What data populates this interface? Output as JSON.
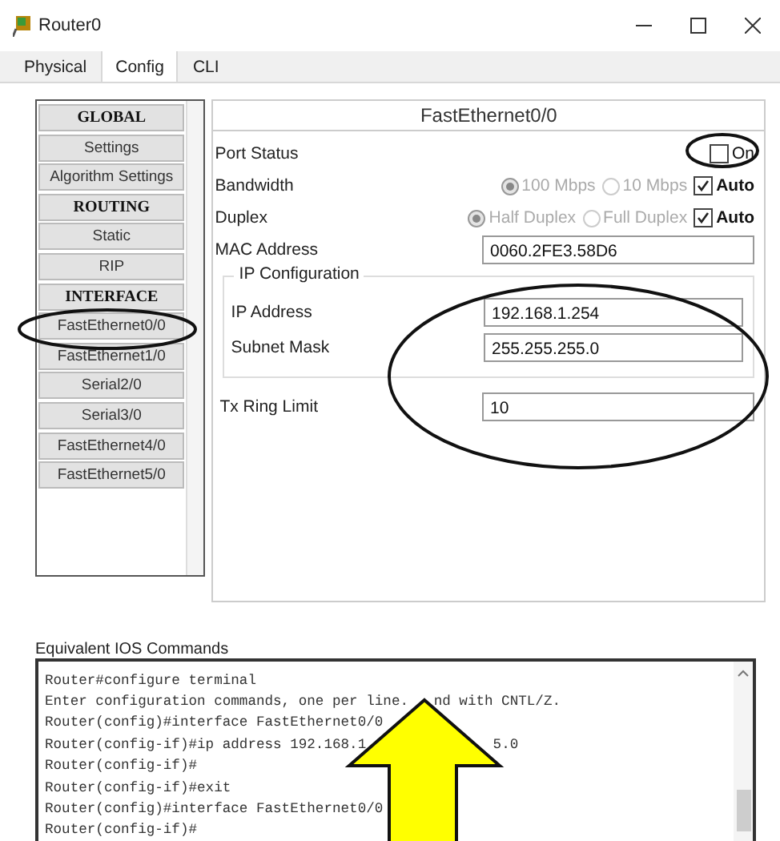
{
  "window": {
    "title": "Router0"
  },
  "tabs": [
    {
      "label": "Physical",
      "selected": false
    },
    {
      "label": "Config",
      "selected": true
    },
    {
      "label": "CLI",
      "selected": false
    }
  ],
  "sidebar": {
    "items": [
      {
        "kind": "header",
        "label": "GLOBAL"
      },
      {
        "kind": "item",
        "label": "Settings"
      },
      {
        "kind": "item",
        "label": "Algorithm Settings"
      },
      {
        "kind": "header",
        "label": "ROUTING"
      },
      {
        "kind": "item",
        "label": "Static"
      },
      {
        "kind": "item",
        "label": "RIP"
      },
      {
        "kind": "header",
        "label": "INTERFACE"
      },
      {
        "kind": "item",
        "label": "FastEthernet0/0"
      },
      {
        "kind": "item",
        "label": "FastEthernet1/0"
      },
      {
        "kind": "item",
        "label": "Serial2/0"
      },
      {
        "kind": "item",
        "label": "Serial3/0"
      },
      {
        "kind": "item",
        "label": "FastEthernet4/0"
      },
      {
        "kind": "item",
        "label": "FastEthernet5/0"
      }
    ]
  },
  "interface_panel": {
    "title": "FastEthernet0/0",
    "port_status": {
      "label": "Port Status",
      "option": {
        "label": "On",
        "checked": false
      }
    },
    "bandwidth": {
      "label": "Bandwidth",
      "disabled": true,
      "options": [
        {
          "label": "100 Mbps",
          "selected": true
        },
        {
          "label": "10 Mbps",
          "selected": false
        }
      ],
      "auto": {
        "label": "Auto",
        "checked": true
      }
    },
    "duplex": {
      "label": "Duplex",
      "disabled": true,
      "options": [
        {
          "label": "Half Duplex",
          "selected": true
        },
        {
          "label": "Full Duplex",
          "selected": false
        }
      ],
      "auto": {
        "label": "Auto",
        "checked": true
      }
    },
    "mac_address": {
      "label": "MAC Address",
      "value": "0060.2FE3.58D6"
    },
    "ip_configuration": {
      "legend": "IP Configuration",
      "fields": [
        {
          "label": "IP Address",
          "value": "192.168.1.254"
        },
        {
          "label": "Subnet Mask",
          "value": "255.255.255.0"
        }
      ]
    },
    "tx_ring_limit": {
      "label": "Tx Ring Limit",
      "value": "10"
    }
  },
  "console": {
    "label": "Equivalent IOS Commands",
    "lines": [
      {
        "segments": [
          "Router#configure terminal"
        ]
      },
      {
        "segments": [
          "Enter configuration commands, one per line.",
          "nd with CNTL/Z."
        ]
      },
      {
        "segments": [
          "Router(config)#interface FastEthernet0/0"
        ]
      },
      {
        "segments": [
          "Router(config-if)#ip address 192.168.1",
          "5.0"
        ]
      },
      {
        "segments": [
          "Router(config-if)#"
        ]
      },
      {
        "segments": [
          "Router(config-if)#exit"
        ]
      },
      {
        "segments": [
          "Router(config)#interface FastEthernet0/0"
        ]
      },
      {
        "segments": [
          "Router(config-if)#"
        ]
      }
    ]
  }
}
